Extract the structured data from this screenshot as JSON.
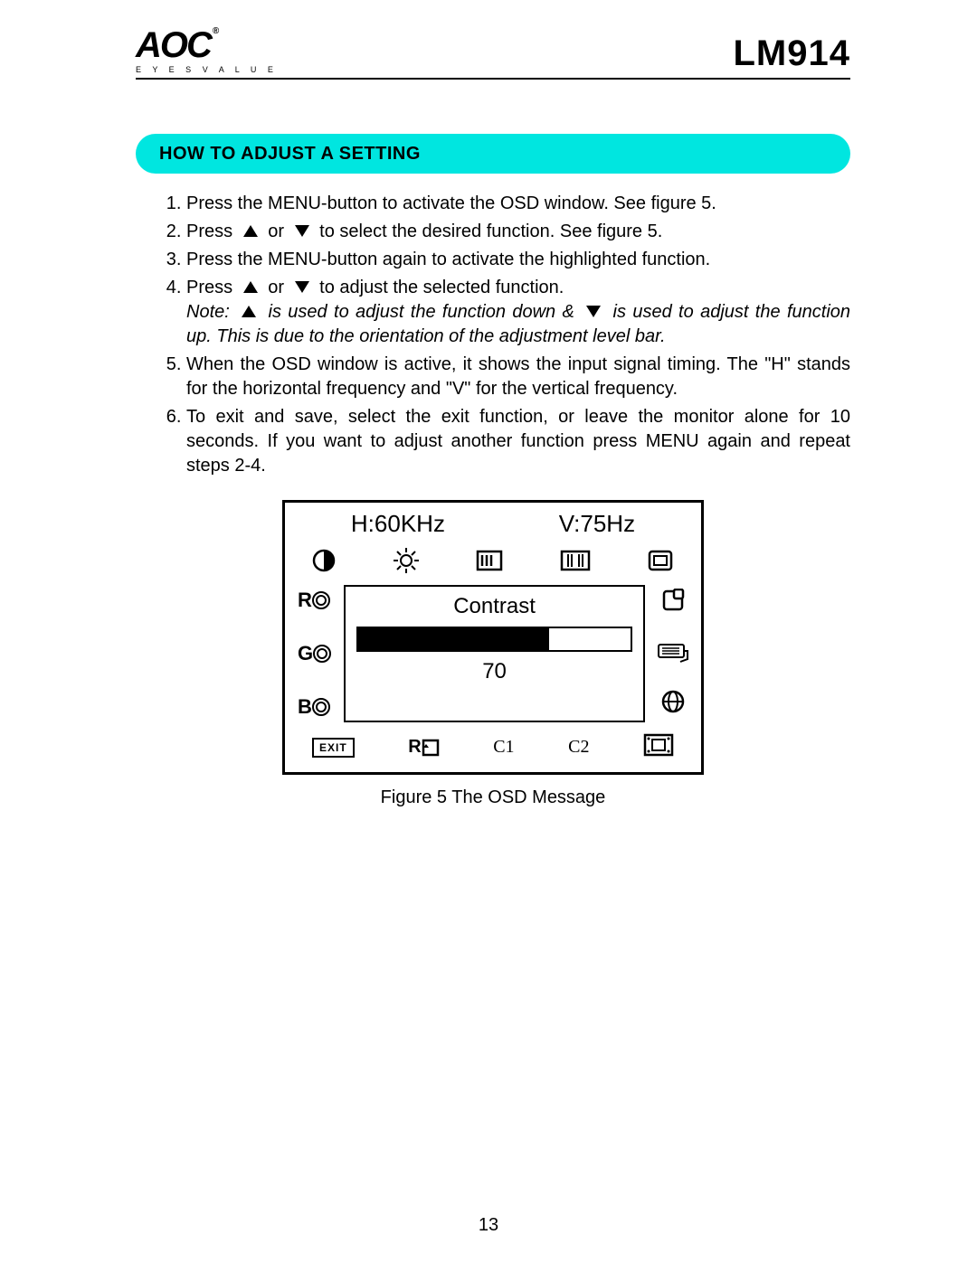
{
  "header": {
    "logo_text": "AOC",
    "logo_reg": "®",
    "logo_tagline": "E Y E S   V A L U E",
    "model": "LM914"
  },
  "section_title": "HOW TO ADJUST A SETTING",
  "steps": {
    "s1": "Press the MENU-button  to activate the OSD window. See figure 5.",
    "s2a": "Press ",
    "s2b": " or ",
    "s2c": " to select the desired function. See figure 5.",
    "s3": "Press the MENU-button again to activate the highlighted function.",
    "s4a": "Press ",
    "s4b": " or ",
    "s4c": " to adjust the selected function.",
    "note_a": "Note: ",
    "note_b": " is used to adjust the function down & ",
    "note_c": " is used to adjust the function up.  This is due to the orientation of the adjustment level bar.",
    "s5": "When the OSD window is active, it shows the input signal timing. The  \"H\" stands for the horizontal frequency and \"V\" for the vertical frequency.",
    "s6": "To exit and save, select the exit function, or leave the monitor alone for 10 seconds. If you want to adjust another function press MENU again and repeat steps 2-4."
  },
  "osd": {
    "h_label": "H:60KHz",
    "v_label": "V:75Hz",
    "left_labels": {
      "r": "R",
      "g": "G",
      "b": "B"
    },
    "center_label": "Contrast",
    "center_value": "70",
    "center_percent": 70,
    "exit_label": "EXIT",
    "bottom_rd": "R",
    "bottom_c1": "C1",
    "bottom_c2": "C2"
  },
  "figure_caption": "Figure 5     The  OSD  Message",
  "page_number": "13"
}
